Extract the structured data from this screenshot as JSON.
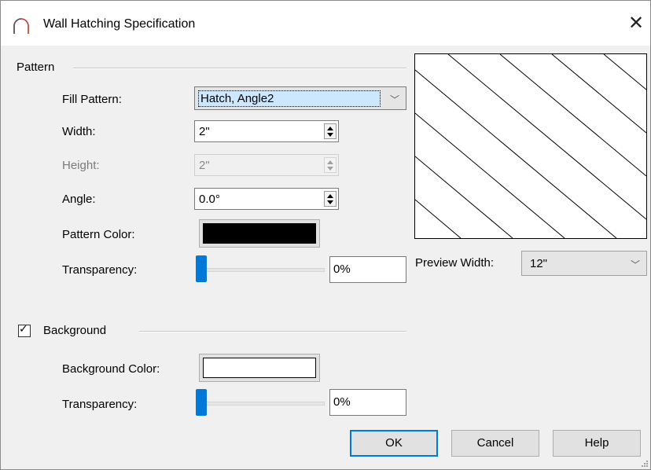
{
  "window": {
    "title": "Wall Hatching Specification",
    "close_icon": "close-icon",
    "app_icon": "arch-icon"
  },
  "pattern": {
    "group_label": "Pattern",
    "fill_pattern_label": "Fill Pattern:",
    "fill_pattern_value": "Hatch, Angle2",
    "width_label": "Width:",
    "width_value": "2\"",
    "height_label": "Height:",
    "height_value": "2\"",
    "angle_label": "Angle:",
    "angle_value": "0.0°",
    "pattern_color_label": "Pattern Color:",
    "pattern_color": "#000000",
    "transparency_label": "Transparency:",
    "transparency_value": "0%",
    "transparency_level": 0
  },
  "preview": {
    "width_label": "Preview Width:",
    "width_value": "12\""
  },
  "background": {
    "group_label": "Background",
    "checked": true,
    "color_label": "Background Color:",
    "color": "#ffffff",
    "transparency_label": "Transparency:",
    "transparency_value": "0%",
    "transparency_level": 0
  },
  "buttons": {
    "ok": "OK",
    "cancel": "Cancel",
    "help": "Help"
  },
  "colors": {
    "accent": "#0078d7",
    "selection": "#cce8ff"
  }
}
